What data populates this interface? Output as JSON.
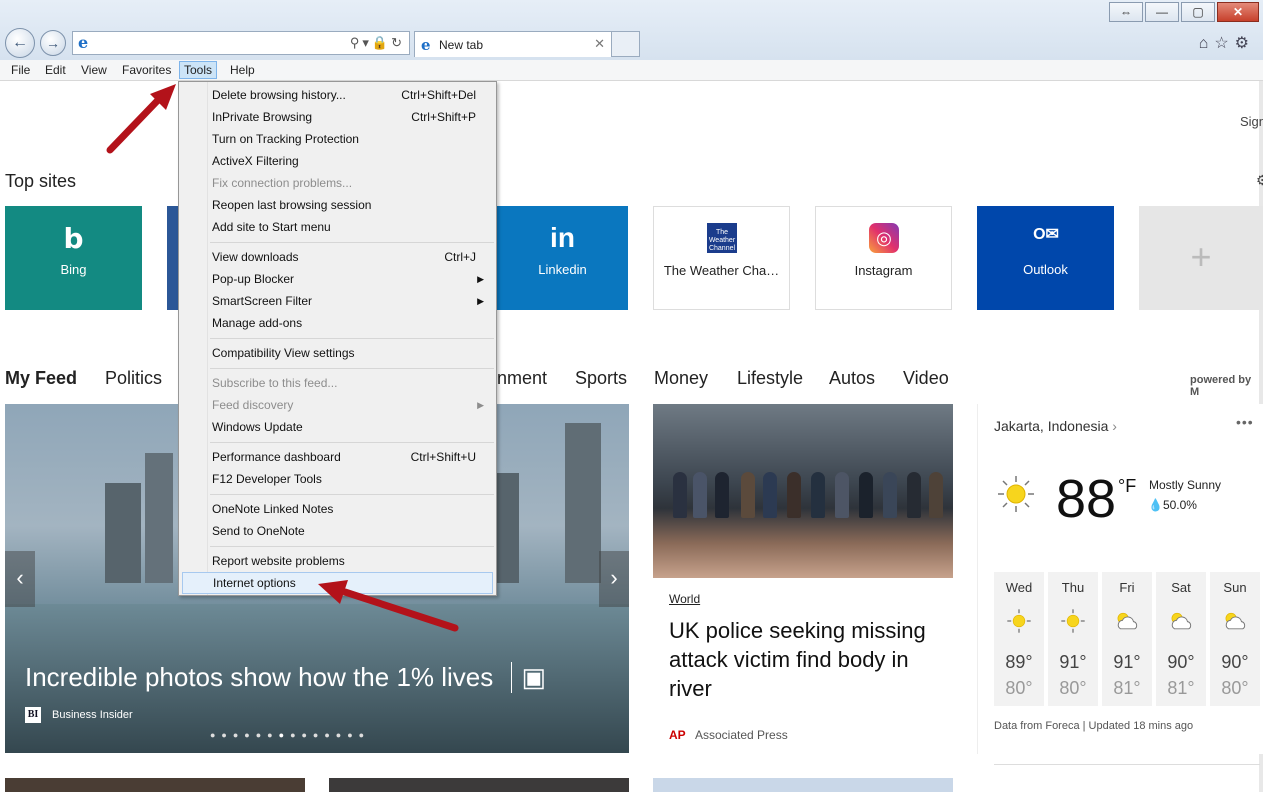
{
  "browser": {
    "tab_label": "New tab",
    "menu": [
      "File",
      "Edit",
      "View",
      "Favorites",
      "Tools",
      "Help"
    ],
    "window_buttons": [
      "⇔",
      "—",
      "▢",
      "✕"
    ]
  },
  "tools_menu": {
    "items": [
      {
        "label": "Delete browsing history...",
        "shortcut": "Ctrl+Shift+Del"
      },
      {
        "label": "InPrivate Browsing",
        "shortcut": "Ctrl+Shift+P"
      },
      {
        "label": "Turn on Tracking Protection",
        "shortcut": ""
      },
      {
        "label": "ActiveX Filtering",
        "shortcut": ""
      },
      {
        "label": "Fix connection problems...",
        "shortcut": ""
      },
      {
        "label": "Reopen last browsing session",
        "shortcut": ""
      },
      {
        "label": "Add site to Start menu",
        "shortcut": ""
      },
      {
        "label": "View downloads",
        "shortcut": "Ctrl+J"
      },
      {
        "label": "Pop-up Blocker",
        "shortcut": ""
      },
      {
        "label": "SmartScreen Filter",
        "shortcut": ""
      },
      {
        "label": "Manage add-ons",
        "shortcut": ""
      },
      {
        "label": "Compatibility View settings",
        "shortcut": ""
      },
      {
        "label": "Subscribe to this feed...",
        "shortcut": ""
      },
      {
        "label": "Feed discovery",
        "shortcut": ""
      },
      {
        "label": "Windows Update",
        "shortcut": ""
      },
      {
        "label": "Performance dashboard",
        "shortcut": "Ctrl+Shift+U"
      },
      {
        "label": "F12 Developer Tools",
        "shortcut": ""
      },
      {
        "label": "OneNote Linked Notes",
        "shortcut": ""
      },
      {
        "label": "Send to OneNote",
        "shortcut": ""
      },
      {
        "label": "Report website problems",
        "shortcut": ""
      },
      {
        "label": "Internet options",
        "shortcut": ""
      }
    ]
  },
  "page": {
    "sign_in_partial": "Sign",
    "top_sites_heading": "Top sites",
    "tiles": [
      {
        "label": "Bing",
        "icon": "b",
        "color": "#138a82"
      },
      {
        "label": "Linkedin",
        "icon": "in",
        "color": "#0a77bf"
      },
      {
        "label": "The Weather Cha…",
        "icon": "TWC",
        "color": "#ffffff"
      },
      {
        "label": "Instagram",
        "icon": "◎",
        "color": "#ffffff"
      },
      {
        "label": "Outlook",
        "icon": "O✉",
        "color": "#0047ab"
      }
    ],
    "feed_tabs": [
      "My Feed",
      "Politics",
      "nment",
      "Sports",
      "Money",
      "Lifestyle",
      "Autos",
      "Video"
    ],
    "powered_by": "powered by M",
    "hero": {
      "title": "Incredible photos show how the 1% lives",
      "source": "Business Insider",
      "source_logo": "BI"
    },
    "news": {
      "category": "World",
      "title": "UK police seeking missing attack victim find body in river",
      "source": "Associated Press",
      "source_logo": "AP"
    },
    "weather": {
      "location": "Jakarta, Indonesia",
      "temp": "88",
      "unit": "°F",
      "condition": "Mostly Sunny",
      "precip": "50.0%",
      "days": [
        {
          "day": "Wed",
          "hi": "89°",
          "lo": "80°",
          "icon": "sun"
        },
        {
          "day": "Thu",
          "hi": "91°",
          "lo": "80°",
          "icon": "sun"
        },
        {
          "day": "Fri",
          "hi": "91°",
          "lo": "81°",
          "icon": "partly-cloudy"
        },
        {
          "day": "Sat",
          "hi": "90°",
          "lo": "81°",
          "icon": "partly-cloudy"
        },
        {
          "day": "Sun",
          "hi": "90°",
          "lo": "80°",
          "icon": "partly-cloudy"
        }
      ],
      "footer": "Data from Foreca | Updated 18 mins ago"
    }
  }
}
